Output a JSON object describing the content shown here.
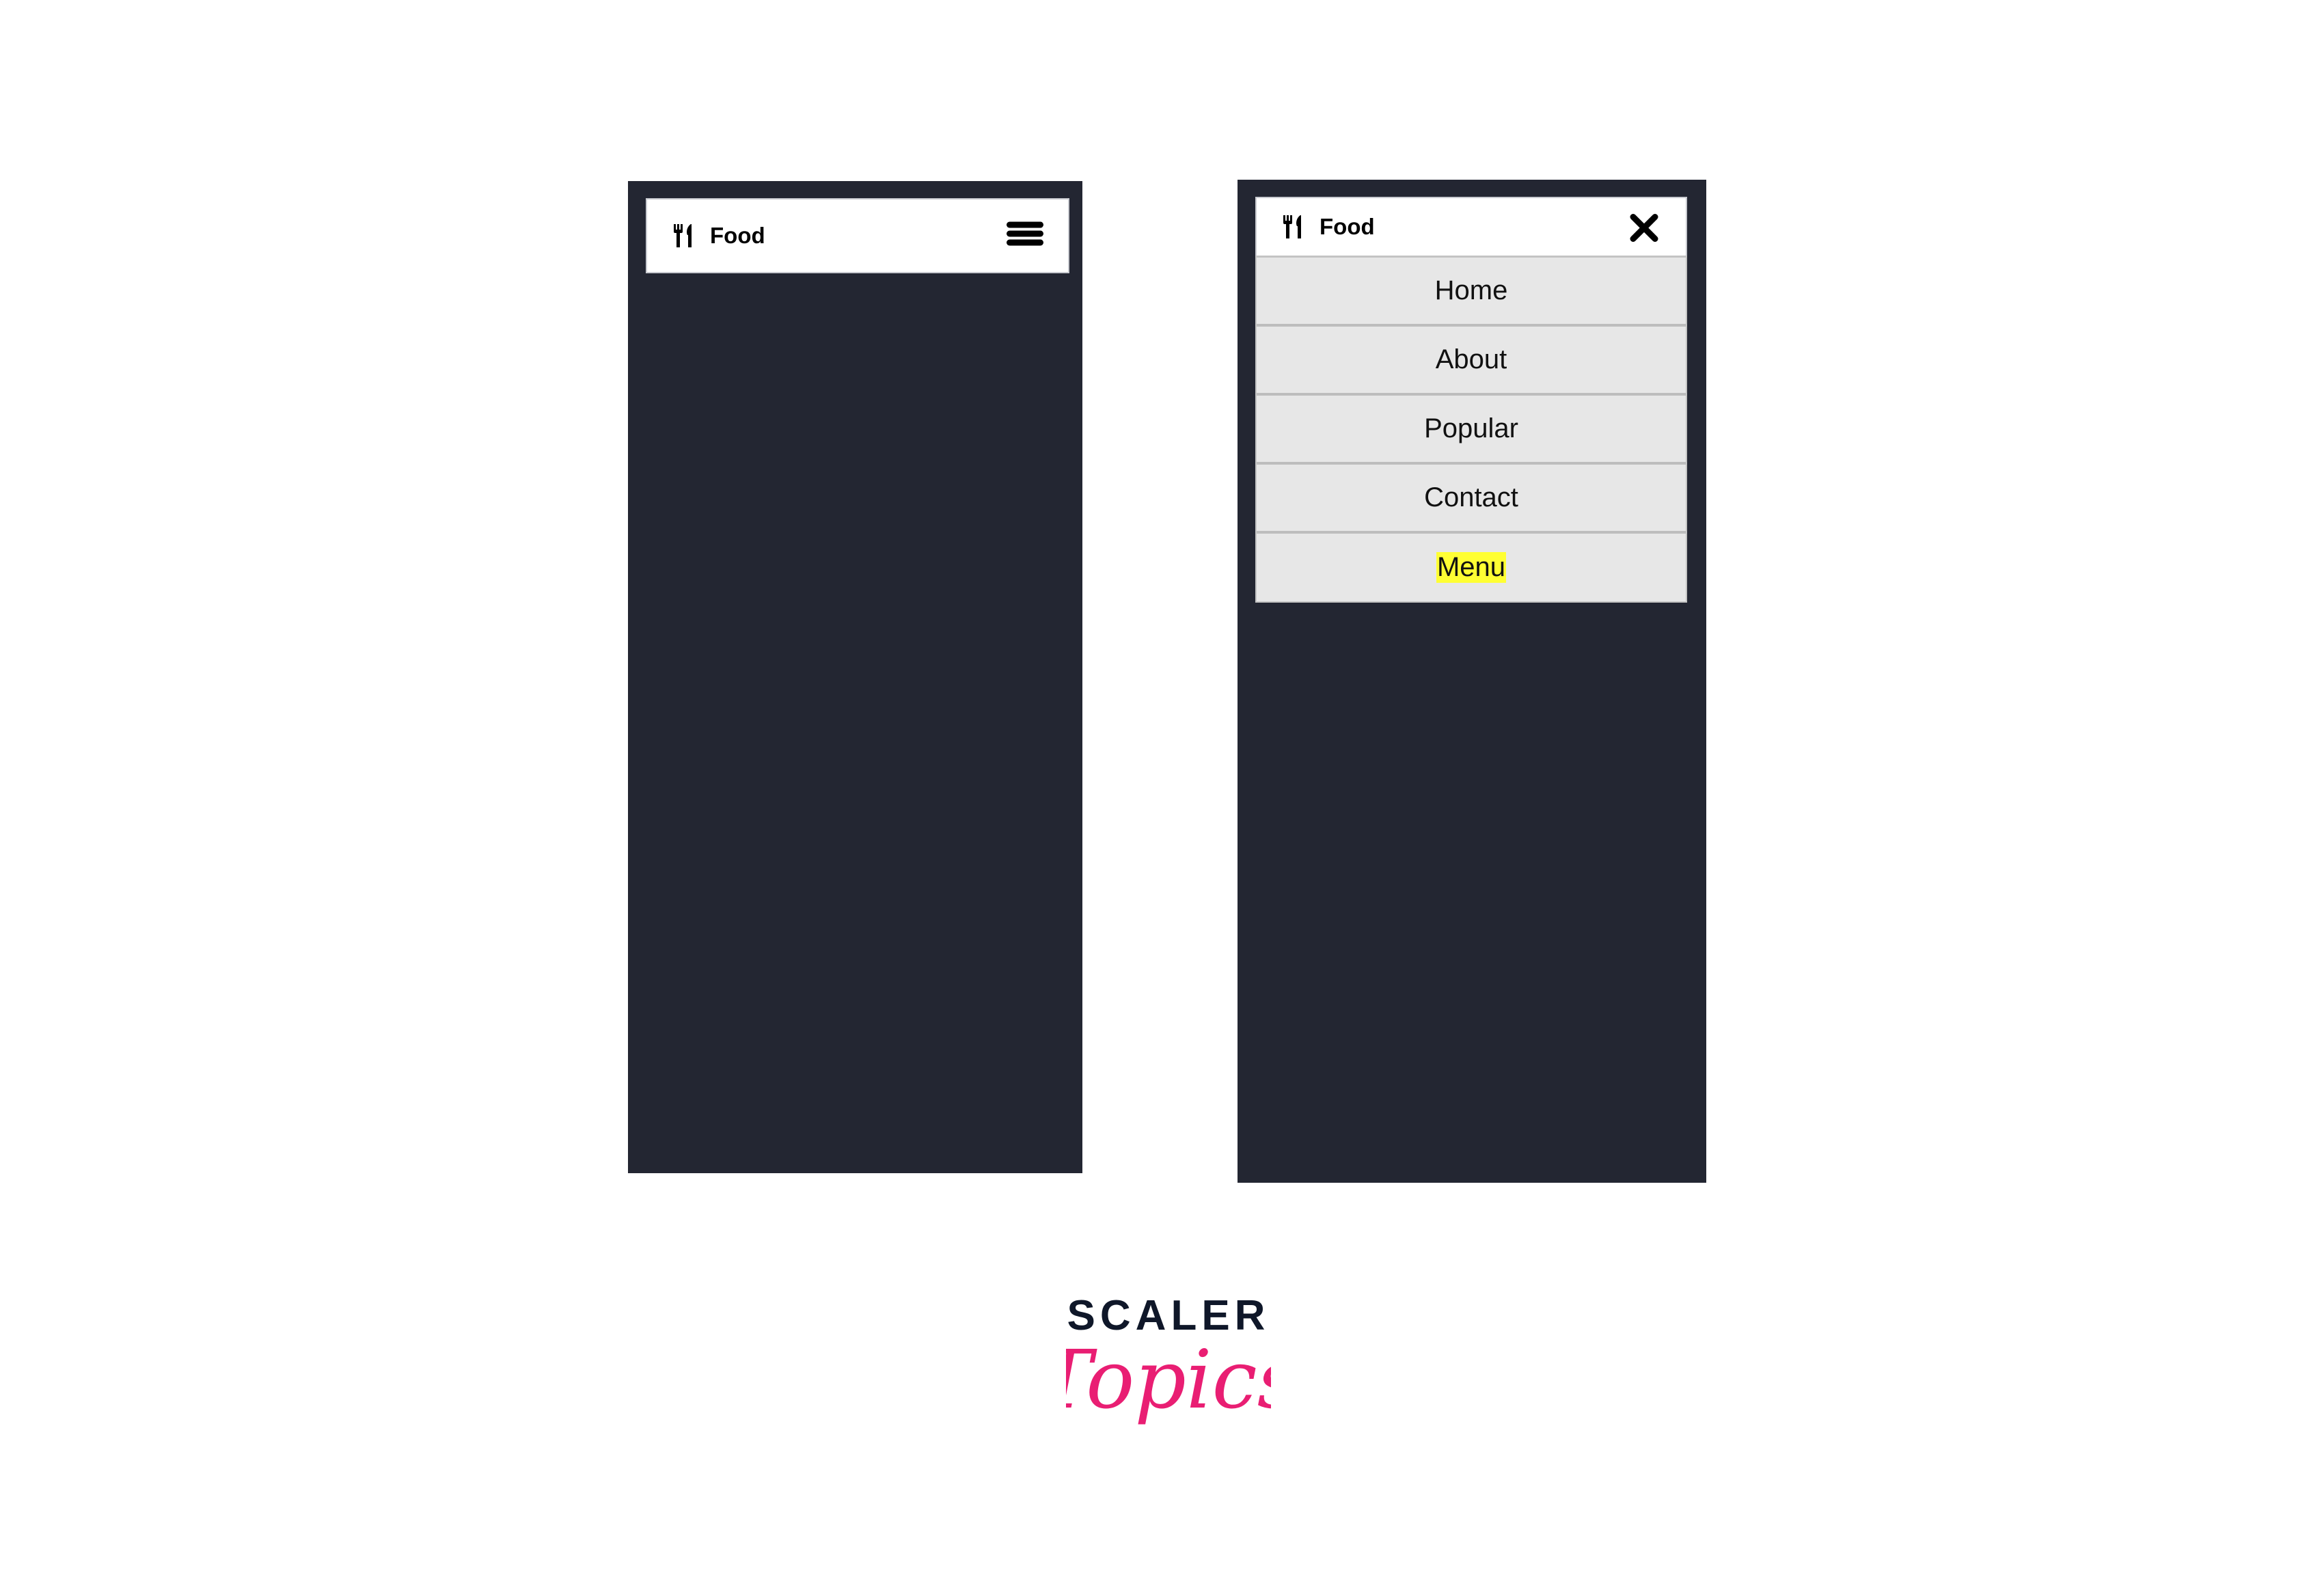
{
  "screens": [
    {
      "state": "collapsed",
      "navbar": {
        "brand_icon": "fork-knife-icon",
        "brand_text": "Food",
        "toggle_icon": "hamburger-menu-icon"
      }
    },
    {
      "state": "expanded",
      "navbar": {
        "brand_icon": "fork-knife-icon",
        "brand_text": "Food",
        "toggle_icon": "close-x-icon"
      },
      "menu": {
        "items": [
          {
            "label": "Home"
          },
          {
            "label": "About"
          },
          {
            "label": "Popular"
          },
          {
            "label": "Contact"
          },
          {
            "label": "Menu",
            "active": true
          }
        ]
      }
    }
  ],
  "colors": {
    "phone_bg": "#232632",
    "navbar_bg": "#ffffff",
    "menu_bg": "#e7e7e7",
    "menu_divider": "#bdbdbd",
    "active_highlight": "#ffff33",
    "logo_dark": "#0f1729",
    "logo_pink": "#e91e73"
  },
  "logo": {
    "line1": "SCALER",
    "line2": "Topics"
  }
}
